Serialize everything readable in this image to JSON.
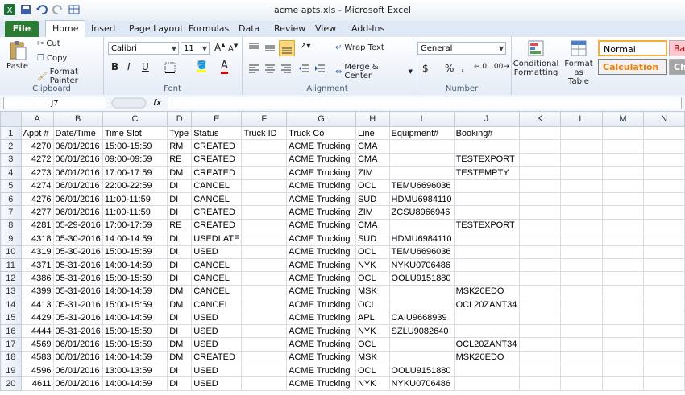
{
  "window": {
    "title": "acme apts.xls - Microsoft Excel"
  },
  "ribbon_tabs": [
    "File",
    "Home",
    "Insert",
    "Page Layout",
    "Formulas",
    "Data",
    "Review",
    "View",
    "Add-Ins"
  ],
  "clipboard": {
    "paste": "Paste",
    "cut": "Cut",
    "copy": "Copy",
    "format_painter": "Format Painter",
    "label": "Clipboard"
  },
  "font": {
    "name": "Calibri",
    "size": "11",
    "bold": "B",
    "italic": "I",
    "underline": "U",
    "label": "Font"
  },
  "alignment": {
    "wrap_text": "Wrap Text",
    "merge_center": "Merge & Center",
    "label": "Alignment"
  },
  "number": {
    "format": "General",
    "dollar": "$",
    "percent": "%",
    "comma": ",",
    "label": "Number"
  },
  "styles": {
    "conditional_formatting": "Conditional Formatting",
    "format_as_table": "Format as Table",
    "normal": "Normal",
    "calculation": "Calculation",
    "bad": "Bad",
    "check": "Che"
  },
  "formula_bar": {
    "cell_ref": "J7",
    "fx": "fx",
    "value": ""
  },
  "sheet": {
    "columns": [
      "A",
      "B",
      "C",
      "D",
      "E",
      "F",
      "G",
      "H",
      "I",
      "J",
      "K",
      "L",
      "M",
      "N"
    ],
    "rows": [
      [
        "Appt #",
        "Date/Time",
        "Time Slot",
        "Type",
        "Status",
        "Truck ID",
        "Truck Co",
        "Line",
        "Equipment#",
        "Booking#",
        "",
        "",
        "",
        ""
      ],
      [
        "4270",
        "06/01/2016",
        "15:00-15:59",
        "RM",
        "CREATED",
        "",
        "ACME Trucking",
        "CMA",
        "",
        "",
        "",
        "",
        "",
        ""
      ],
      [
        "4272",
        "06/01/2016",
        "09:00-09:59",
        "RE",
        "CREATED",
        "",
        "ACME Trucking",
        "CMA",
        "",
        "TESTEXPORT",
        "",
        "",
        "",
        ""
      ],
      [
        "4273",
        "06/01/2016",
        "17:00-17:59",
        "DM",
        "CREATED",
        "",
        "ACME Trucking",
        "ZIM",
        "",
        "TESTEMPTY",
        "",
        "",
        "",
        ""
      ],
      [
        "4274",
        "06/01/2016",
        "22:00-22:59",
        "DI",
        "CANCEL",
        "",
        "ACME Trucking",
        "OCL",
        "TEMU6696036",
        "",
        "",
        "",
        "",
        ""
      ],
      [
        "4276",
        "06/01/2016",
        "11:00-11:59",
        "DI",
        "CANCEL",
        "",
        "ACME Trucking",
        "SUD",
        "HDMU6984110",
        "",
        "",
        "",
        "",
        ""
      ],
      [
        "4277",
        "06/01/2016",
        "11:00-11:59",
        "DI",
        "CREATED",
        "",
        "ACME Trucking",
        "ZIM",
        "ZCSU8966946",
        "",
        "",
        "",
        "",
        ""
      ],
      [
        "4281",
        "05-29-2016",
        "17:00-17:59",
        "RE",
        "CREATED",
        "",
        "ACME Trucking",
        "CMA",
        "",
        "TESTEXPORT",
        "",
        "",
        "",
        ""
      ],
      [
        "4318",
        "05-30-2016",
        "14:00-14:59",
        "DI",
        "USEDLATE",
        "",
        "ACME Trucking",
        "SUD",
        "HDMU6984110",
        "",
        "",
        "",
        "",
        ""
      ],
      [
        "4319",
        "05-30-2016",
        "15:00-15:59",
        "DI",
        "USED",
        "",
        "ACME Trucking",
        "OCL",
        "TEMU6696036",
        "",
        "",
        "",
        "",
        ""
      ],
      [
        "4371",
        "05-31-2016",
        "14:00-14:59",
        "DI",
        "CANCEL",
        "",
        "ACME Trucking",
        "NYK",
        "NYKU0706486",
        "",
        "",
        "",
        "",
        ""
      ],
      [
        "4386",
        "05-31-2016",
        "15:00-15:59",
        "DI",
        "CANCEL",
        "",
        "ACME Trucking",
        "OCL",
        "OOLU9151880",
        "",
        "",
        "",
        "",
        ""
      ],
      [
        "4399",
        "05-31-2016",
        "14:00-14:59",
        "DM",
        "CANCEL",
        "",
        "ACME Trucking",
        "MSK",
        "",
        "MSK20EDO",
        "",
        "",
        "",
        ""
      ],
      [
        "4413",
        "05-31-2016",
        "15:00-15:59",
        "DM",
        "CANCEL",
        "",
        "ACME Trucking",
        "OCL",
        "",
        "OCL20ZANT34",
        "",
        "",
        "",
        ""
      ],
      [
        "4429",
        "05-31-2016",
        "14:00-14:59",
        "DI",
        "USED",
        "",
        "ACME Trucking",
        "APL",
        "CAIU9668939",
        "",
        "",
        "",
        "",
        ""
      ],
      [
        "4444",
        "05-31-2016",
        "15:00-15:59",
        "DI",
        "USED",
        "",
        "ACME Trucking",
        "NYK",
        "SZLU9082640",
        "",
        "",
        "",
        "",
        ""
      ],
      [
        "4569",
        "06/01/2016",
        "15:00-15:59",
        "DM",
        "USED",
        "",
        "ACME Trucking",
        "OCL",
        "",
        "OCL20ZANT34",
        "",
        "",
        "",
        ""
      ],
      [
        "4583",
        "06/01/2016",
        "14:00-14:59",
        "DM",
        "CREATED",
        "",
        "ACME Trucking",
        "MSK",
        "",
        "MSK20EDO",
        "",
        "",
        "",
        ""
      ],
      [
        "4596",
        "06/01/2016",
        "13:00-13:59",
        "DI",
        "USED",
        "",
        "ACME Trucking",
        "OCL",
        "OOLU9151880",
        "",
        "",
        "",
        "",
        ""
      ],
      [
        "4611",
        "06/01/2016",
        "14:00-14:59",
        "DI",
        "USED",
        "",
        "ACME Trucking",
        "NYK",
        "NYKU0706486",
        "",
        "",
        "",
        "",
        ""
      ]
    ]
  },
  "colors": {
    "file_tab": "#2a7c32",
    "calculation": "#f0a030",
    "bad_bg": "#ffc7ce",
    "bad_fg": "#9c0006"
  }
}
